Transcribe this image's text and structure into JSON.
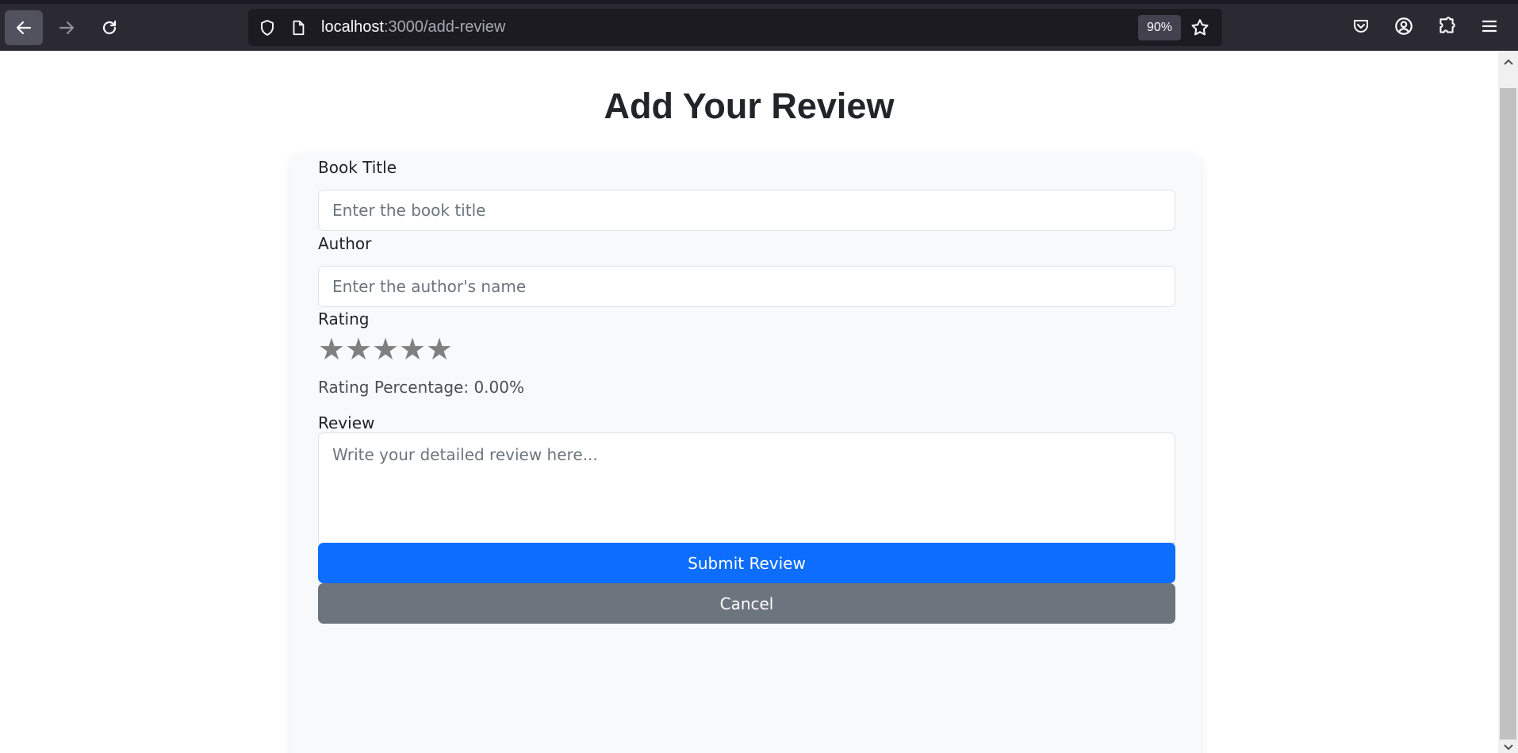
{
  "browser": {
    "url_host": "localhost",
    "url_path": ":3000/add-review",
    "zoom": "90%",
    "icons": {
      "back": "arrow-left-icon",
      "forward": "arrow-right-icon",
      "reload": "reload-icon",
      "shield": "shield-icon",
      "page": "page-icon",
      "bookmark": "star-icon",
      "pocket": "pocket-icon",
      "account": "account-icon",
      "extensions": "puzzle-icon",
      "menu": "hamburger-menu-icon"
    }
  },
  "page": {
    "title": "Add Your Review"
  },
  "form": {
    "book_title_label": "Book Title",
    "book_title_placeholder": "Enter the book title",
    "book_title_value": "",
    "author_label": "Author",
    "author_placeholder": "Enter the author's name",
    "author_value": "",
    "rating_label": "Rating",
    "rating_value": 0,
    "rating_max": 5,
    "rating_star_glyph": "★",
    "rating_percentage_text": "Rating Percentage: 0.00%",
    "review_label": "Review",
    "review_placeholder": "Write your detailed review here...",
    "review_value": "",
    "submit_label": "Submit Review",
    "cancel_label": "Cancel"
  },
  "colors": {
    "primary": "#0d6efd",
    "secondary": "#6c757d",
    "star_inactive": "#808080"
  }
}
